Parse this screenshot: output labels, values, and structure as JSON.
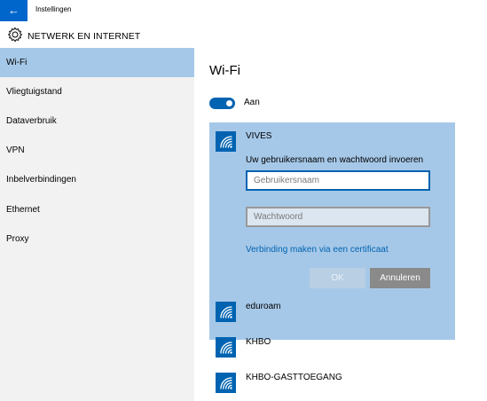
{
  "window": {
    "back_glyph": "←",
    "title": "Instellingen"
  },
  "header": {
    "icon": "gear-icon",
    "title": "NETWERK EN INTERNET"
  },
  "sidebar": {
    "items": [
      {
        "label": "Wi-Fi",
        "selected": true
      },
      {
        "label": "Vliegtuigstand",
        "selected": false
      },
      {
        "label": "Dataverbruik",
        "selected": false
      },
      {
        "label": "VPN",
        "selected": false
      },
      {
        "label": "Inbelverbindingen",
        "selected": false
      },
      {
        "label": "Ethernet",
        "selected": false
      },
      {
        "label": "Proxy",
        "selected": false
      }
    ]
  },
  "main": {
    "title": "Wi-Fi",
    "toggle": {
      "state": "on",
      "label": "Aan"
    },
    "selected_network": {
      "name": "VIVES",
      "prompt": "Uw gebruikersnaam en wachtwoord invoeren",
      "username_placeholder": "Gebruikersnaam",
      "password_placeholder": "Wachtwoord",
      "certificate_link": "Verbinding maken via een certificaat",
      "ok_label": "OK",
      "cancel_label": "Annuleren"
    },
    "networks": [
      {
        "name": "eduroam"
      },
      {
        "name": "KHBO"
      },
      {
        "name": "KHBO-GASTTOEGANG"
      }
    ]
  },
  "colors": {
    "accent": "#0063b1",
    "selection": "#a6c8e8",
    "sidebar_bg": "#f2f2f2"
  }
}
